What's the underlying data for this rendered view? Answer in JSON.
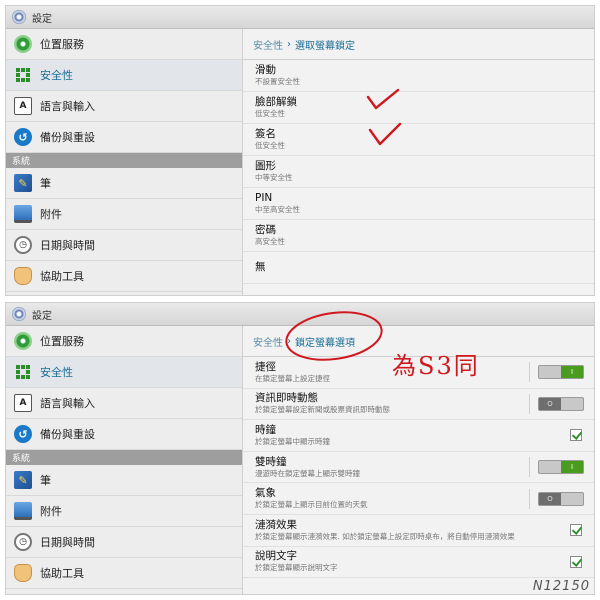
{
  "panel1": {
    "window_title": "設定",
    "sidebar": {
      "items": [
        {
          "label": "位置服務",
          "icon": "location-icon",
          "active": false
        },
        {
          "label": "安全性",
          "icon": "security-icon",
          "active": true
        },
        {
          "label": "語言與輸入",
          "icon": "language-icon",
          "active": false
        },
        {
          "label": "備份與重設",
          "icon": "backup-icon",
          "active": false
        }
      ],
      "section_header": "系統",
      "system_items": [
        {
          "label": "筆",
          "icon": "pen-icon"
        },
        {
          "label": "附件",
          "icon": "accessory-icon"
        },
        {
          "label": "日期與時間",
          "icon": "clock-icon"
        },
        {
          "label": "協助工具",
          "icon": "hand-icon"
        }
      ]
    },
    "breadcrumb": {
      "root": "安全性",
      "separator": "›",
      "current": "選取螢幕鎖定"
    },
    "options": [
      {
        "title": "滑動",
        "subtitle": "不設置安全性"
      },
      {
        "title": "臉部解鎖",
        "subtitle": "低安全性"
      },
      {
        "title": "簽名",
        "subtitle": "低安全性"
      },
      {
        "title": "圖形",
        "subtitle": "中等安全性"
      },
      {
        "title": "PIN",
        "subtitle": "中至高安全性"
      },
      {
        "title": "密碼",
        "subtitle": "高安全性"
      },
      {
        "title": "無",
        "subtitle": ""
      }
    ]
  },
  "panel2": {
    "window_title": "設定",
    "sidebar": {
      "items": [
        {
          "label": "位置服務",
          "icon": "location-icon",
          "active": false
        },
        {
          "label": "安全性",
          "icon": "security-icon",
          "active": true
        },
        {
          "label": "語言與輸入",
          "icon": "language-icon",
          "active": false
        },
        {
          "label": "備份與重設",
          "icon": "backup-icon",
          "active": false
        }
      ],
      "section_header": "系統",
      "system_items": [
        {
          "label": "筆",
          "icon": "pen-icon"
        },
        {
          "label": "附件",
          "icon": "accessory-icon"
        },
        {
          "label": "日期與時間",
          "icon": "clock-icon"
        },
        {
          "label": "協助工具",
          "icon": "hand-icon"
        }
      ]
    },
    "breadcrumb": {
      "root": "安全性",
      "separator": "›",
      "current": "鎖定螢幕選項"
    },
    "options": [
      {
        "title": "捷徑",
        "subtitle": "在鎖定螢幕上設定捷徑",
        "control": "toggle",
        "state": "on",
        "state_label": "I"
      },
      {
        "title": "資訊即時動態",
        "subtitle": "於鎖定螢幕設定新聞或股票資訊即時動態",
        "control": "toggle",
        "state": "off",
        "state_label": "O"
      },
      {
        "title": "時鐘",
        "subtitle": "於鎖定螢幕中顯示時鐘",
        "control": "checkbox",
        "checked": true
      },
      {
        "title": "雙時鐘",
        "subtitle": "漫遊時在鎖定螢幕上顯示雙時鐘",
        "control": "toggle",
        "state": "on",
        "state_label": "I"
      },
      {
        "title": "氣象",
        "subtitle": "於鎖定螢幕上顯示目前位置的天氣",
        "control": "toggle",
        "state": "off",
        "state_label": "O"
      },
      {
        "title": "漣漪效果",
        "subtitle": "於鎖定螢幕顯示漣漪效果. 如於鎖定螢幕上設定即時桌布，將自動停用漣漪效果",
        "control": "checkbox",
        "checked": true
      },
      {
        "title": "說明文字",
        "subtitle": "於鎖定螢幕顯示說明文字",
        "control": "checkbox",
        "checked": true
      }
    ]
  },
  "annotations": {
    "handwritten_note": "為S3同"
  },
  "watermark": "N12150",
  "colors": {
    "accent": "#1a6d95",
    "section_header": "#9e9e9e",
    "toggle_on": "#4a9c1f",
    "check": "#2f8f2f",
    "handwriting": "#d0181f"
  }
}
